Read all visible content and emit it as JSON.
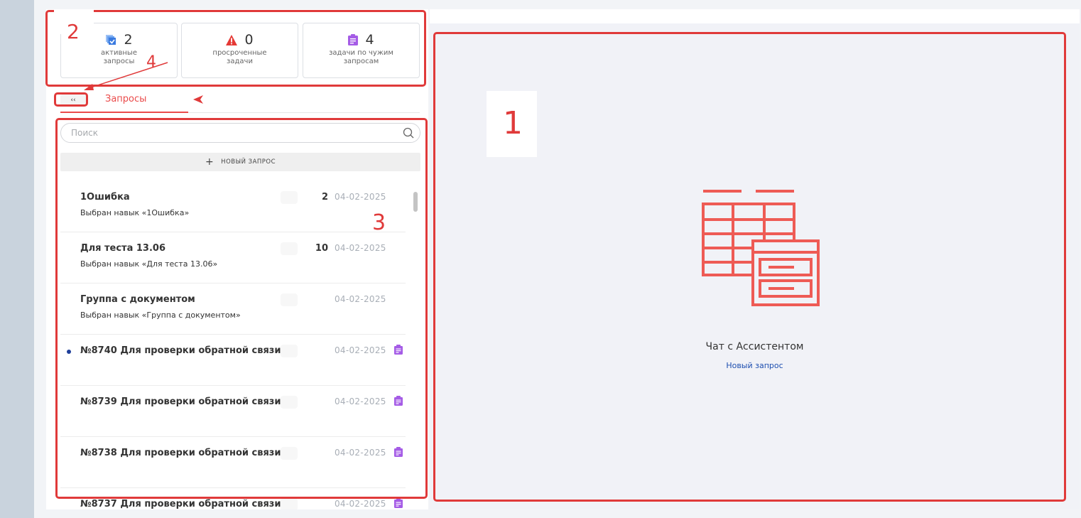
{
  "stats": [
    {
      "value": "2",
      "label": "активные\nзапросы",
      "icon": "checklist-icon"
    },
    {
      "value": "0",
      "label": "просроченные\nзадачи",
      "icon": "warning-icon"
    },
    {
      "value": "4",
      "label": "задачи по чужим\nзапросам",
      "icon": "clipboard-icon"
    }
  ],
  "tabs": {
    "collapse_label": "‹‹",
    "requests_label": "Запросы"
  },
  "search": {
    "placeholder": "Поиск",
    "icon": "search-icon"
  },
  "new_request": {
    "label": "НОВЫЙ ЗАПРОС",
    "icon": "plus-icon"
  },
  "requests": [
    {
      "title": "1Ошибка",
      "subtitle": "Выбран навык «1Ошибка»",
      "count": "2",
      "date": "04-02-2025",
      "unread": false,
      "clip": false
    },
    {
      "title": "Для теста 13.06",
      "subtitle": "Выбран навык «Для теста 13.06»",
      "count": "10",
      "date": "04-02-2025",
      "unread": false,
      "clip": false
    },
    {
      "title": "Группа с документом",
      "subtitle": "Выбран навык «Группа с документом»",
      "count": "",
      "date": "04-02-2025",
      "unread": false,
      "clip": false
    },
    {
      "title": "№8740 Для проверки обратной связи",
      "subtitle": "",
      "count": "",
      "date": "04-02-2025",
      "unread": true,
      "clip": true
    },
    {
      "title": "№8739 Для проверки обратной связи",
      "subtitle": "",
      "count": "",
      "date": "04-02-2025",
      "unread": false,
      "clip": true
    },
    {
      "title": "№8738 Для проверки обратной связи",
      "subtitle": "",
      "count": "",
      "date": "04-02-2025",
      "unread": false,
      "clip": true
    },
    {
      "title": "№8737 Для проверки обратной связи",
      "subtitle": "",
      "count": "",
      "date": "04-02-2025",
      "unread": false,
      "clip": true
    }
  ],
  "empty_state": {
    "title": "Чат с Ассистентом",
    "link": "Новый запрос",
    "icon": "table-forms-icon"
  },
  "annotations": {
    "n1": "1",
    "n2": "2",
    "n3": "3",
    "n4": "4"
  },
  "colors": {
    "accent": "#ea4b4b",
    "annotation": "#e03a3a",
    "link": "#1e4fb0",
    "clip": "#a55ce6",
    "stat_blue": "#3a7ae0"
  }
}
